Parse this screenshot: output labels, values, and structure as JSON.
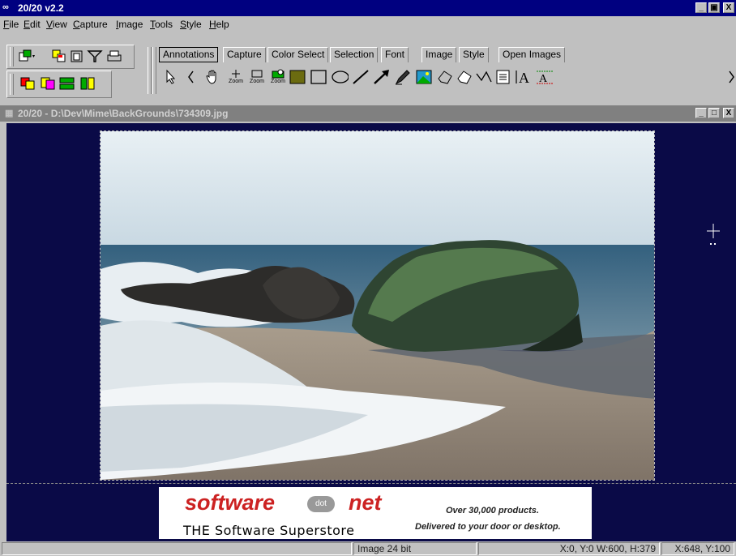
{
  "app": {
    "title": "20/20 v2.2",
    "icon": "glasses-icon"
  },
  "title_controls": {
    "minimize": "_",
    "restore": "і",
    "close": "X"
  },
  "menu": {
    "items": [
      {
        "label": "File",
        "accel": "F",
        "rest": "ile"
      },
      {
        "label": "Edit",
        "accel": "E",
        "rest": "dit"
      },
      {
        "label": "View",
        "accel": "V",
        "rest": "iew"
      },
      {
        "label": "Capture",
        "accel": "C",
        "rest": "apture"
      },
      {
        "label": "Image",
        "accel": "I",
        "rest": "mage"
      },
      {
        "label": "Tools",
        "accel": "T",
        "rest": "ools"
      },
      {
        "label": "Style",
        "accel": "S",
        "rest": "tyle"
      },
      {
        "label": "Help",
        "accel": "H",
        "rest": "elp"
      }
    ]
  },
  "tabs": {
    "items": [
      "Annotations",
      "Capture",
      "Color Select",
      "Selection",
      "Font",
      "Image",
      "Style",
      "Open Images"
    ],
    "active": "Annotations"
  },
  "tools": {
    "zoom_label": "Zoom"
  },
  "child": {
    "title": "20/20 - D:\\Dev\\Mime\\BackGrounds\\734309.jpg"
  },
  "ad": {
    "brand_left": "software",
    "brand_dot": "dot",
    "brand_right": "net",
    "tagline": "THE Software Superstore",
    "line1": "Over 30,000 products.",
    "line2": "Delivered to your door or desktop."
  },
  "status": {
    "mode": "Image 24 bit",
    "selection": "X:0, Y:0  W:600, H:379",
    "cursor": "X:648, Y:100"
  },
  "colors": {
    "titlebar": "#000080",
    "canvas_bg": "#0a0a47",
    "ad_red": "#cc2222"
  }
}
